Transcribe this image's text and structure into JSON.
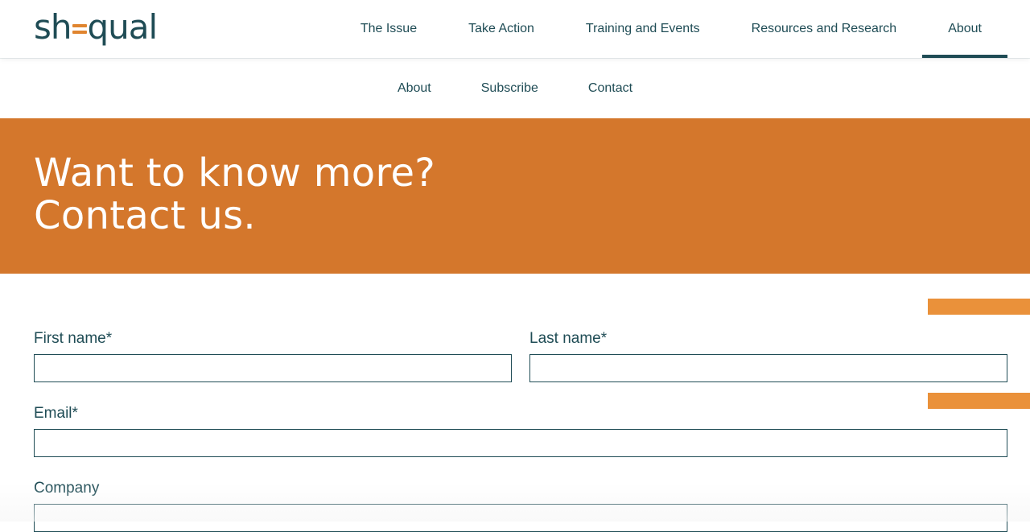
{
  "brand": {
    "logo_left": "sh",
    "logo_right": "qual",
    "logo_full": "shequal",
    "primary_color": "#1f4c55",
    "accent_color": "#d4772c",
    "stripe_color": "#ea913a"
  },
  "main_nav": {
    "items": [
      {
        "label": "The Issue"
      },
      {
        "label": "Take Action"
      },
      {
        "label": "Training and Events"
      },
      {
        "label": "Resources and Research"
      },
      {
        "label": "About",
        "active": true
      }
    ]
  },
  "sub_nav": {
    "items": [
      {
        "label": "About"
      },
      {
        "label": "Subscribe"
      },
      {
        "label": "Contact"
      }
    ]
  },
  "hero": {
    "line1": "Want to know more?",
    "line2": "Contact us."
  },
  "form": {
    "first_name": {
      "label": "First name*",
      "value": ""
    },
    "last_name": {
      "label": "Last name*",
      "value": ""
    },
    "email": {
      "label": "Email*",
      "value": ""
    },
    "company": {
      "label": "Company",
      "value": ""
    }
  }
}
